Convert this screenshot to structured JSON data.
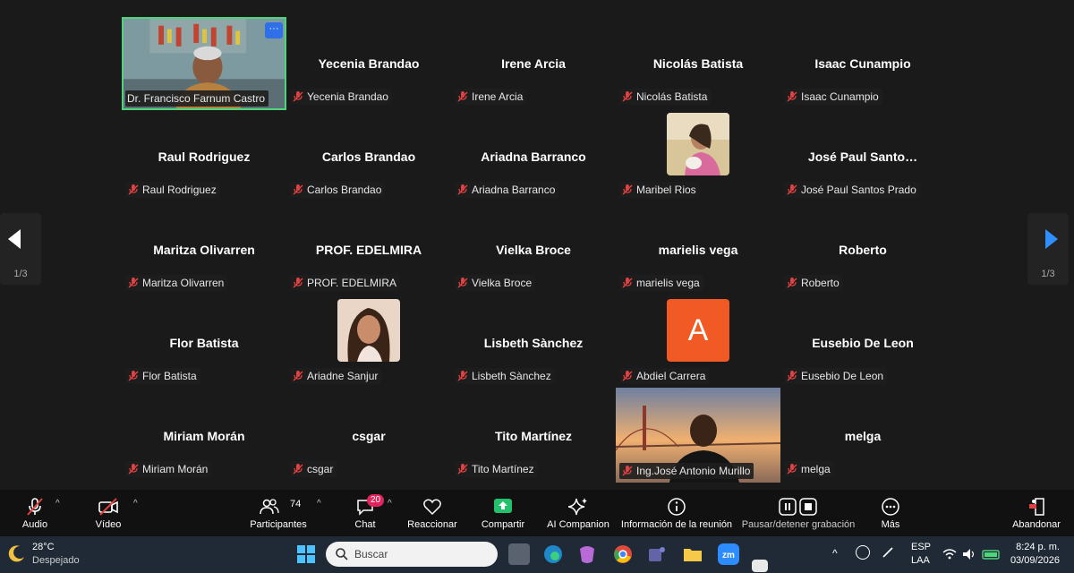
{
  "gallery": {
    "page_left": "1/3",
    "page_right": "1/3",
    "tiles": [
      {
        "name": "",
        "label": "Dr. Francisco Farnum Castro"
      },
      {
        "name": "Yecenia Brandao",
        "label": "Yecenia Brandao"
      },
      {
        "name": "Irene Arcia",
        "label": "Irene Arcia"
      },
      {
        "name": "Nicolás Batista",
        "label": "Nicolás Batista"
      },
      {
        "name": "Isaac Cunampio",
        "label": "Isaac Cunampio"
      },
      {
        "name": "Raul Rodriguez",
        "label": "Raul Rodriguez"
      },
      {
        "name": "Carlos Brandao",
        "label": "Carlos Brandao"
      },
      {
        "name": "Ariadna Barranco",
        "label": "Ariadna Barranco"
      },
      {
        "name": "",
        "label": "Maribel Rios"
      },
      {
        "name": "José  Paul  Santo…",
        "label": "José Paul Santos Prado"
      },
      {
        "name": "Maritza Olivarren",
        "label": "Maritza Olivarren"
      },
      {
        "name": "PROF. EDELMIRA",
        "label": "PROF. EDELMIRA"
      },
      {
        "name": "Vielka Broce",
        "label": "Vielka Broce"
      },
      {
        "name": "marielis vega",
        "label": "marielis vega"
      },
      {
        "name": "Roberto",
        "label": "Roberto"
      },
      {
        "name": "Flor Batista",
        "label": "Flor Batista"
      },
      {
        "name": "",
        "label": "Ariadne Sanjur"
      },
      {
        "name": "Lisbeth Sànchez",
        "label": "Lisbeth Sànchez"
      },
      {
        "name": "",
        "label": "Abdiel Carrera",
        "initial": "A"
      },
      {
        "name": "Eusebio De Leon",
        "label": "Eusebio De Leon"
      },
      {
        "name": "Miriam Morán",
        "label": "Miriam Morán"
      },
      {
        "name": "csgar",
        "label": "csgar"
      },
      {
        "name": "Tito  Martínez",
        "label": "Tito  Martínez"
      },
      {
        "name": "",
        "label": "Ing.José Antonio Murillo"
      },
      {
        "name": "melga",
        "label": "melga"
      }
    ],
    "more_button": "···"
  },
  "toolbar": {
    "audio": "Audio",
    "video": "Vídeo",
    "participants": "Participantes",
    "participants_count": "74",
    "chat": "Chat",
    "chat_badge": "20",
    "react": "Reaccionar",
    "share": "Compartir",
    "ai": "AI Companion",
    "info": "Información de la reunión",
    "record": "Pausar/detener grabación",
    "more": "Más",
    "leave": "Abandonar"
  },
  "taskbar": {
    "weather_temp": "28°C",
    "weather_desc": "Despejado",
    "search_placeholder": "Buscar",
    "lang": "ESP",
    "lang_sub": "LAA",
    "time": "8:24 p. m.",
    "date": "03/09/2026"
  },
  "colors": {
    "accent": "#2f6fe8",
    "speaker_border": "#4fd37b",
    "mute_red": "#e04040",
    "share_green": "#23c16b",
    "avatar_orange": "#f15a24",
    "chat_badge": "#e0245e"
  }
}
